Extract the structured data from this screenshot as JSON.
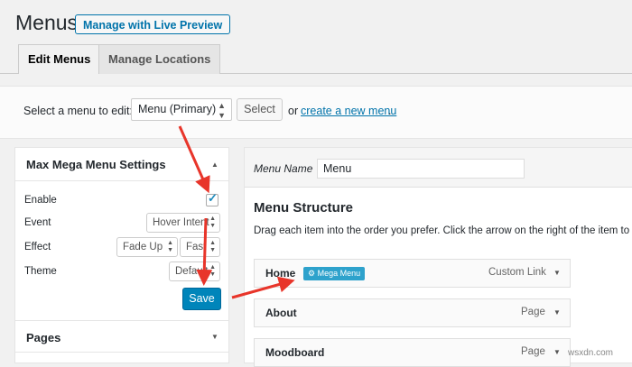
{
  "header": {
    "title": "Menus",
    "live_preview_label": "Manage with Live Preview"
  },
  "tabs": [
    {
      "label": "Edit Menus",
      "active": true
    },
    {
      "label": "Manage Locations",
      "active": false
    }
  ],
  "menu_select": {
    "label": "Select a menu to edit:",
    "current": "Menu (Primary)",
    "select_button": "Select",
    "or_text": "or",
    "create_link": "create a new menu",
    "period": "."
  },
  "mega_menu_settings": {
    "title": "Max Mega Menu Settings",
    "enable_label": "Enable",
    "enable_checked": true,
    "event_label": "Event",
    "event_value": "Hover Intent",
    "effect_label": "Effect",
    "effect_value": "Fade Up",
    "effect_speed": "Fast",
    "theme_label": "Theme",
    "theme_value": "Default",
    "save_label": "Save"
  },
  "pages_section": {
    "label": "Pages"
  },
  "menu_editor": {
    "name_label": "Menu Name",
    "name_value": "Menu",
    "structure_title": "Menu Structure",
    "structure_desc": "Drag each item into the order you prefer. Click the arrow on the right of the item to",
    "items": [
      {
        "title": "Home",
        "badge": "Mega Menu",
        "type": "Custom Link"
      },
      {
        "title": "About",
        "type": "Page"
      },
      {
        "title": "Moodboard",
        "type": "Page"
      }
    ]
  },
  "watermark": "wsxdn.com",
  "colors": {
    "accent": "#0073aa",
    "primary_button": "#0085ba",
    "badge": "#2ea2cc",
    "arrows": "#e8352a"
  }
}
